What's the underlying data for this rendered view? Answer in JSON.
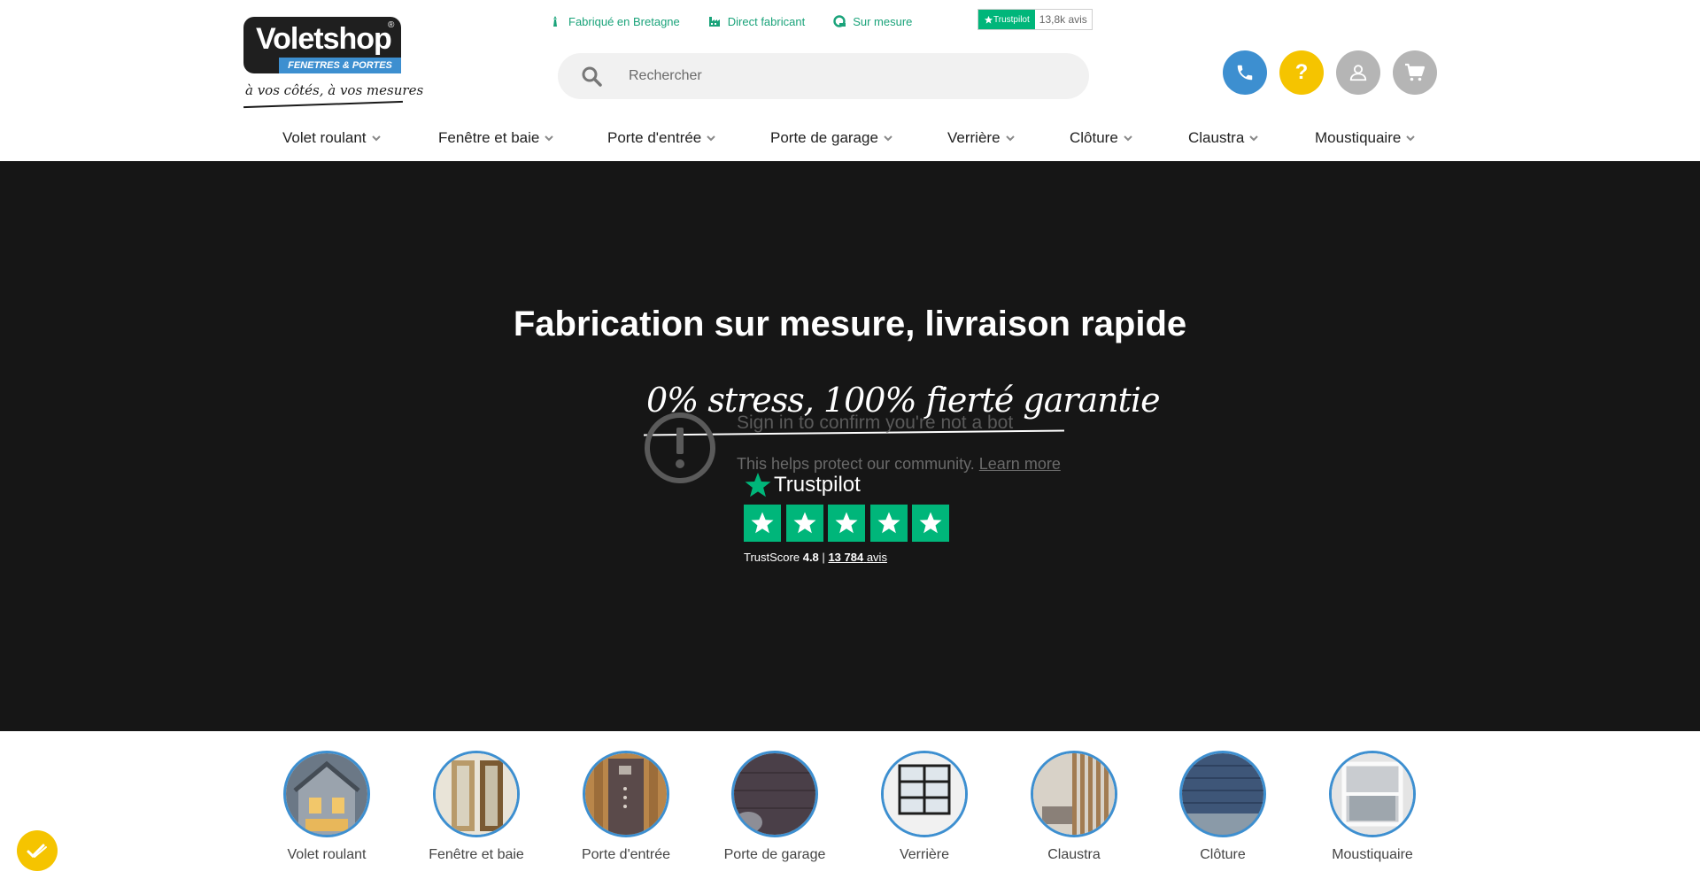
{
  "brand": {
    "name": "Voletshop",
    "registered": "®",
    "tagline": "FENETRES & PORTES",
    "slogan": "à vos côtés, à vos mesures"
  },
  "features": [
    {
      "label": "Fabriqué en Bretagne",
      "icon": "bretagne-icon"
    },
    {
      "label": "Direct fabricant",
      "icon": "factory-icon"
    },
    {
      "label": "Sur mesure",
      "icon": "measure-icon"
    }
  ],
  "trustpilot_badge": {
    "label": "Trustpilot",
    "count": "13,8k avis"
  },
  "search": {
    "placeholder": "Rechercher"
  },
  "actions": {
    "help": "?"
  },
  "nav": [
    {
      "label": "Volet roulant"
    },
    {
      "label": "Fenêtre et baie"
    },
    {
      "label": "Porte d'entrée"
    },
    {
      "label": "Porte de garage"
    },
    {
      "label": "Verrière"
    },
    {
      "label": "Clôture"
    },
    {
      "label": "Claustra"
    },
    {
      "label": "Moustiquaire"
    }
  ],
  "hero": {
    "title_1": "Fabrication ",
    "title_2": "sur mesure",
    "title_3": ", livraison ",
    "title_4": "rapide",
    "subtitle": "0% stress, 100% fierté garantie"
  },
  "captcha": {
    "title": "Sign in to confirm you're not a bot",
    "text": "This helps protect our community.",
    "link": "Learn more"
  },
  "trustpilot_widget": {
    "name": "Trustpilot",
    "score_label": "TrustScore",
    "score": "4.8",
    "separator": "|",
    "reviews": "13 784",
    "reviews_suffix": "avis"
  },
  "categories": [
    {
      "label": "Volet roulant"
    },
    {
      "label": "Fenêtre et baie"
    },
    {
      "label": "Porte d'entrée"
    },
    {
      "label": "Porte de garage"
    },
    {
      "label": "Verrière"
    },
    {
      "label": "Claustra"
    },
    {
      "label": "Clôture"
    },
    {
      "label": "Moustiquaire"
    }
  ],
  "colors": {
    "accent_blue": "#3d8fd0",
    "accent_yellow": "#f5c400",
    "trustpilot_green": "#00b67a",
    "feature_green": "#1aa37a",
    "hero_bg": "#161616"
  }
}
